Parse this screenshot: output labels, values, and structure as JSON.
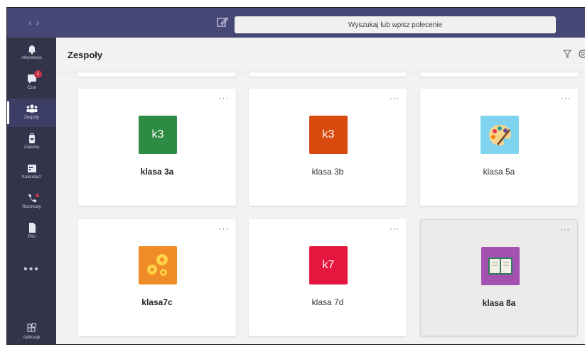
{
  "titlebar": {
    "back_glyph": "‹",
    "forward_glyph": "›",
    "search_placeholder": "Wyszukaj lub wpisz polecenie"
  },
  "rail": {
    "items": [
      {
        "label": "Aktywność"
      },
      {
        "label": "Czat",
        "badge": "1"
      },
      {
        "label": "Zespoły"
      },
      {
        "label": "Zadania"
      },
      {
        "label": "Kalendarz"
      },
      {
        "label": "Rozmowy"
      },
      {
        "label": "Pliki"
      }
    ],
    "more": "•••",
    "apps": "Aplikacje"
  },
  "header": {
    "title": "Zespoły"
  },
  "teams": [
    {
      "name": "klasa 3a",
      "tile_text": "k3",
      "tile_color": "#2e8b43",
      "bold": true
    },
    {
      "name": "klasa 3b",
      "tile_text": "k3",
      "tile_color": "#d84a0e",
      "bold": false
    },
    {
      "name": "klasa 5a",
      "tile_text": "",
      "tile_color": "#80d3ee",
      "icon": "palette-icon",
      "bold": false
    },
    {
      "name": "klasa7c",
      "tile_text": "",
      "tile_color": "#f08c27",
      "icon": "gears-icon",
      "bold": true
    },
    {
      "name": "klasa 7d",
      "tile_text": "k7",
      "tile_color": "#e6173e",
      "bold": false
    },
    {
      "name": "klasa 8a",
      "tile_text": "",
      "tile_color": "#a352b2",
      "icon": "book-icon",
      "bold": true
    }
  ],
  "card_more": "···",
  "colors": {
    "titlebar": "#464775",
    "rail": "#33344a",
    "background": "#f3f2f1"
  }
}
